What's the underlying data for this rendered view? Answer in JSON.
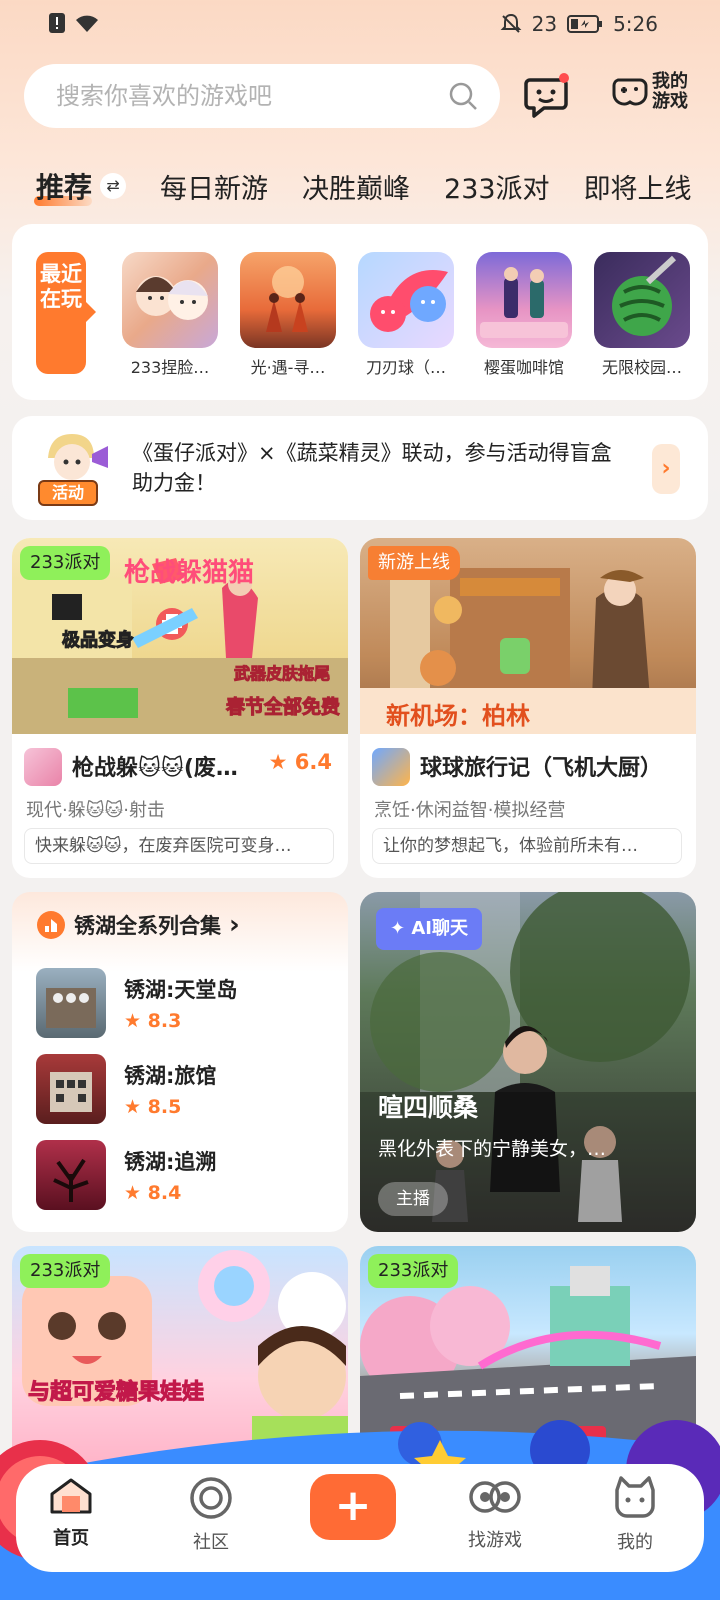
{
  "status_bar": {
    "battery_level": "23",
    "time": "5:26"
  },
  "search": {
    "placeholder": "搜索你喜欢的游戏吧"
  },
  "header": {
    "my_games_label": "我的游戏"
  },
  "tabs": [
    {
      "label": "推荐",
      "active": true
    },
    {
      "label": "每日新游"
    },
    {
      "label": "决胜巅峰"
    },
    {
      "label": "233派对"
    },
    {
      "label": "即将上线"
    }
  ],
  "recent": {
    "tag": "最近在玩",
    "games": [
      {
        "name": "233捏脸…"
      },
      {
        "name": "光·遇-寻…"
      },
      {
        "name": "刀刃球（…"
      },
      {
        "name": "樱蛋咖啡馆"
      },
      {
        "name": "无限校园…"
      }
    ]
  },
  "banner": {
    "badge": "活动",
    "text": "《蛋仔派对》×《蔬菜精灵》联动，参与活动得盲盒助力金！"
  },
  "cards": [
    {
      "tag": "233派对",
      "name": "枪战躲🐱🐱(废…",
      "rating": "6.4",
      "meta": "现代·躲🐱🐱·射击",
      "desc": "快来躲🐱🐱，在废弃医院可变身…",
      "img_texts": {
        "t1": "枪战躲猫猫",
        "t2": "极品变身",
        "t3": "武器皮肤拖尾",
        "t4": "春节全部免费"
      }
    },
    {
      "tag": "新游上线",
      "name": "球球旅行记（飞机大厨）",
      "meta": "烹饪·休闲益智·模拟经营",
      "desc": "让你的梦想起飞，体验前所未有…",
      "img_texts": {
        "t1": "新机场：柏林"
      }
    }
  ],
  "collection": {
    "title": "锈湖全系列合集",
    "items": [
      {
        "name": "锈湖:天堂岛",
        "rating": "8.3"
      },
      {
        "name": "锈湖:旅馆",
        "rating": "8.5"
      },
      {
        "name": "锈湖:追溯",
        "rating": "8.4"
      }
    ]
  },
  "ai_chat": {
    "chip": "AI聊天",
    "title": "暄四顺桑",
    "desc": "黑化外表下的宁静美女，…",
    "badge": "主播"
  },
  "bottom_cards": [
    {
      "tag": "233派对",
      "img_text": "与超可爱糖果娃娃"
    },
    {
      "tag": "233派对"
    }
  ],
  "bottom_nav": [
    {
      "label": "首页",
      "active": true
    },
    {
      "label": "社区"
    },
    {
      "label": "找游戏"
    },
    {
      "label": "我的"
    }
  ],
  "colors": {
    "accent": "#ff7a2e",
    "party_tag": "#8ff05a",
    "ai_chip": "#6b7cf6"
  }
}
